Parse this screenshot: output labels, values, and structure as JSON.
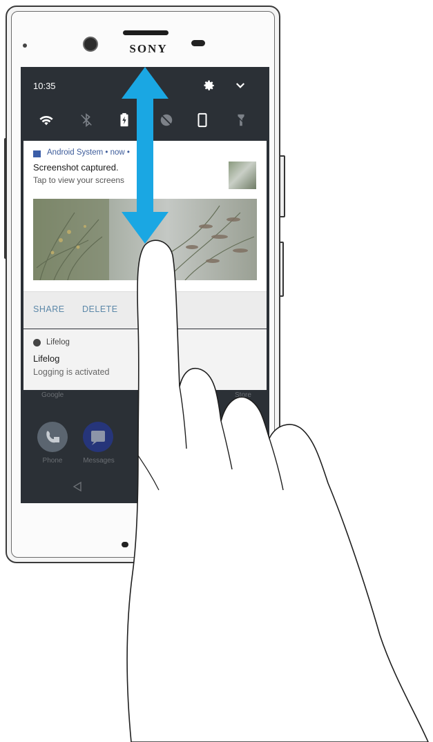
{
  "device": {
    "brand": "SONY"
  },
  "status_bar": {
    "time": "10:35"
  },
  "notifications": [
    {
      "app": "Android System • now •",
      "title": "Screenshot captured.",
      "body": "Tap to view your screens",
      "actions": [
        "SHARE",
        "DELETE"
      ]
    },
    {
      "app": "Lifelog",
      "title": "Lifelog",
      "body": "Logging is activated"
    }
  ],
  "home_screen": {
    "labels": [
      "Google",
      "Store"
    ],
    "apps": [
      "Phone",
      "Messages"
    ]
  },
  "icons": {
    "quick_settings": [
      "wifi-icon",
      "bluetooth-icon",
      "battery-saver-icon",
      "do-not-disturb-icon",
      "auto-rotate-icon",
      "flashlight-icon"
    ],
    "header": [
      "gear-icon",
      "chevron-down-icon"
    ],
    "gesture": [
      "double-arrow-icon",
      "finger-hand-icon"
    ]
  },
  "colors": {
    "arrow": "#1aa7e3",
    "shade_background": "#2b3036",
    "action_text": "#5b87a8"
  }
}
